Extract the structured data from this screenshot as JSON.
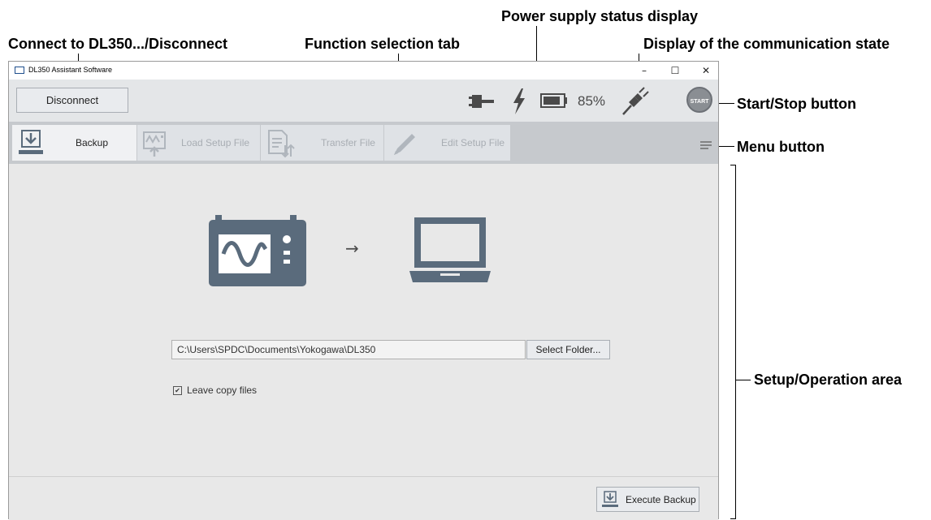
{
  "annotations": {
    "connect": "Connect to DL350.../Disconnect",
    "function_tab": "Function selection tab",
    "power_supply": "Power supply status display",
    "comm_state": "Display of the communication state",
    "start_stop": "Start/Stop button",
    "menu": "Menu button",
    "setup_area": "Setup/Operation area"
  },
  "window": {
    "title": "DL350 Assistant Software",
    "controls": {
      "minimize": "–",
      "maximize": "☐",
      "close": "✕"
    }
  },
  "toolbar": {
    "disconnect_label": "Disconnect",
    "battery_percent": "85%",
    "battery_level": 0.85,
    "start_label": "START"
  },
  "tabs": [
    {
      "label": "Backup",
      "icon": "backup-icon",
      "active": true
    },
    {
      "label": "Load Setup File",
      "icon": "load-setup-icon",
      "active": false
    },
    {
      "label": "Transfer File",
      "icon": "transfer-file-icon",
      "active": false
    },
    {
      "label": "Edit Setup File",
      "icon": "edit-pencil-icon",
      "active": false
    }
  ],
  "menu_icon": "hamburger-icon",
  "main": {
    "folder_path": "C:\\Users\\SPDC\\Documents\\Yokogawa\\DL350",
    "select_folder_label": "Select Folder...",
    "checkbox_checked": true,
    "checkbox_mark": "✔",
    "checkbox_label": "Leave copy files",
    "arrow_glyph": "→"
  },
  "footer": {
    "execute_label": "Execute Backup"
  },
  "colors": {
    "icon_slate": "#5a6b7c",
    "icon_dim": "#b0b6bd",
    "tab_bar": "#c6c9cd",
    "start_button": "#8a8e93"
  }
}
